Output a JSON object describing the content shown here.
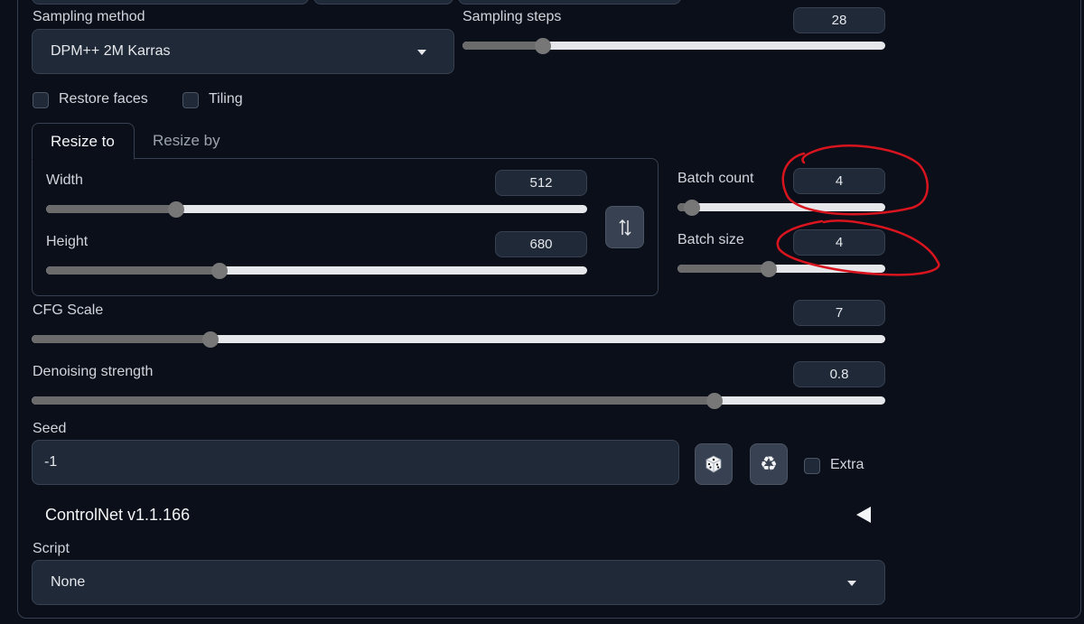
{
  "sampling": {
    "method_label": "Sampling method",
    "method_value": "DPM++ 2M Karras",
    "steps_label": "Sampling steps",
    "steps_value": "28",
    "steps_level": 0.19
  },
  "options": {
    "restore_faces_label": "Restore faces",
    "tiling_label": "Tiling"
  },
  "resize": {
    "tabs": [
      "Resize to",
      "Resize by"
    ],
    "width_label": "Width",
    "width_value": "512",
    "width_level": 0.24,
    "height_label": "Height",
    "height_value": "680",
    "height_level": 0.32,
    "swap_icon": "swap-vertical-icon"
  },
  "batch": {
    "count_label": "Batch count",
    "count_value": "4",
    "count_level": 0.07,
    "size_label": "Batch size",
    "size_value": "4",
    "size_level": 0.44
  },
  "cfg": {
    "label": "CFG Scale",
    "value": "7",
    "level": 0.21
  },
  "denoise": {
    "label": "Denoising strength",
    "value": "0.8",
    "level": 0.8
  },
  "seed": {
    "label": "Seed",
    "value": "-1",
    "dice_icon": "dice-icon",
    "recycle_icon": "recycle-icon",
    "extra_label": "Extra"
  },
  "controlnet": {
    "title": "ControlNet v1.1.166",
    "collapse_icon": "triangle-left-icon"
  },
  "script": {
    "label": "Script",
    "value": "None"
  },
  "colors": {
    "background": "#0b0f19",
    "panel": "#1f2937",
    "border": "#374151",
    "slider_fill": "#6b6b6b",
    "slider_track": "#e5e7eb",
    "annotation_red": "#d8141e"
  }
}
